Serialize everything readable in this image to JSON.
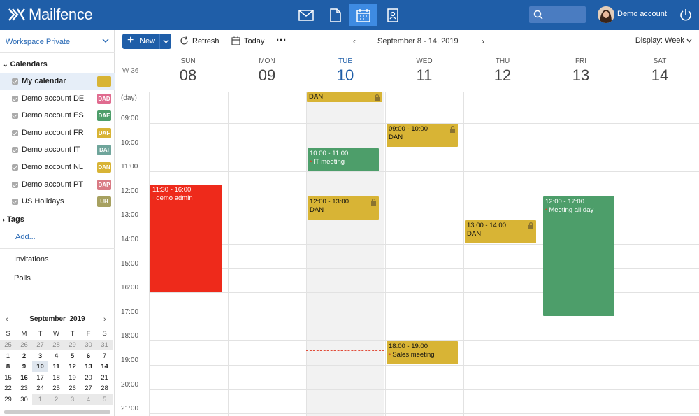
{
  "app": {
    "brand": "Mailfence",
    "account": "Demo account"
  },
  "topbar": {
    "icons": [
      "mail-icon",
      "document-icon",
      "calendar-icon",
      "contacts-icon"
    ],
    "active": "calendar-icon"
  },
  "sidebar": {
    "workspace": "Workspace Private",
    "calendars_title": "Calendars",
    "calendars": [
      {
        "name": "My calendar",
        "badge": "",
        "color": "#d8b435"
      },
      {
        "name": "Demo account DE",
        "badge": "DAD",
        "color": "#e06b8f"
      },
      {
        "name": "Demo account ES",
        "badge": "DAE",
        "color": "#4d9e6a"
      },
      {
        "name": "Demo account FR",
        "badge": "DAF",
        "color": "#d8b435"
      },
      {
        "name": "Demo account IT",
        "badge": "DAI",
        "color": "#6fa59b"
      },
      {
        "name": "Demo account NL",
        "badge": "DAN",
        "color": "#d8b435"
      },
      {
        "name": "Demo account PT",
        "badge": "DAP",
        "color": "#d97a84"
      },
      {
        "name": "US Holidays",
        "badge": "UH",
        "color": "#a7a160"
      }
    ],
    "tags_title": "Tags",
    "add_label": "Add...",
    "invitations": "Invitations",
    "polls": "Polls"
  },
  "mini_calendar": {
    "month": "September",
    "year": "2019",
    "weekdays": [
      "S",
      "M",
      "T",
      "W",
      "T",
      "F",
      "S"
    ],
    "weeks": [
      [
        "25",
        "26",
        "27",
        "28",
        "29",
        "30",
        "31"
      ],
      [
        "1",
        "2",
        "3",
        "4",
        "5",
        "6",
        "7"
      ],
      [
        "8",
        "9",
        "10",
        "11",
        "12",
        "13",
        "14"
      ],
      [
        "15",
        "16",
        "17",
        "18",
        "19",
        "20",
        "21"
      ],
      [
        "22",
        "23",
        "24",
        "25",
        "26",
        "27",
        "28"
      ],
      [
        "29",
        "30",
        "1",
        "2",
        "3",
        "4",
        "5"
      ]
    ]
  },
  "toolbar": {
    "new_label": "New",
    "refresh_label": "Refresh",
    "today_label": "Today",
    "more_label": "···",
    "range": "September 8 - 14, 2019",
    "display": "Display: Week"
  },
  "calendar": {
    "week_label": "W 36",
    "days": [
      {
        "name": "SUN",
        "num": "08"
      },
      {
        "name": "MON",
        "num": "09"
      },
      {
        "name": "TUE",
        "num": "10",
        "today": true
      },
      {
        "name": "WED",
        "num": "11"
      },
      {
        "name": "THU",
        "num": "12"
      },
      {
        "name": "FRI",
        "num": "13"
      },
      {
        "name": "SAT",
        "num": "14"
      }
    ],
    "allday_label": "(day)",
    "hours": [
      "09:00",
      "10:00",
      "11:00",
      "12:00",
      "13:00",
      "14:00",
      "15:00",
      "16:00",
      "17:00",
      "18:00",
      "19:00",
      "20:00",
      "21:00"
    ],
    "allday_events": [
      {
        "day": 2,
        "title": "DAN",
        "color": "#d8b435",
        "locked": true
      }
    ],
    "events": [
      {
        "day": 3,
        "start": 9,
        "end": 10,
        "time": "09:00 - 10:00",
        "title": "DAN",
        "color": "#d8b435",
        "locked": true,
        "dot": false
      },
      {
        "day": 2,
        "start": 10,
        "end": 11,
        "time": "10:00 - 11:00",
        "title": "IT meeting",
        "color": "#4d9e6a",
        "locked": false,
        "dot": true,
        "white": true
      },
      {
        "day": 0,
        "start": 11.5,
        "end": 16,
        "time": "11:30 - 16:00",
        "title": "demo admin",
        "color": "#ee2a1b",
        "locked": false,
        "dot": true,
        "white": true
      },
      {
        "day": 2,
        "start": 12,
        "end": 13,
        "time": "12:00 - 13:00",
        "title": "DAN",
        "color": "#d8b435",
        "locked": true,
        "dot": false
      },
      {
        "day": 5,
        "start": 12,
        "end": 17,
        "time": "12:00 - 17:00",
        "title": "Meeting all day",
        "color": "#4d9e6a",
        "locked": false,
        "dot": true,
        "white": true
      },
      {
        "day": 4,
        "start": 13,
        "end": 14,
        "time": "13:00 - 14:00",
        "title": "DAN",
        "color": "#d8b435",
        "locked": true,
        "dot": false
      },
      {
        "day": 3,
        "start": 18,
        "end": 19,
        "time": "18:00 - 19:00",
        "title": "Sales meeting",
        "color": "#d8b435",
        "locked": false,
        "dot": true
      }
    ]
  }
}
